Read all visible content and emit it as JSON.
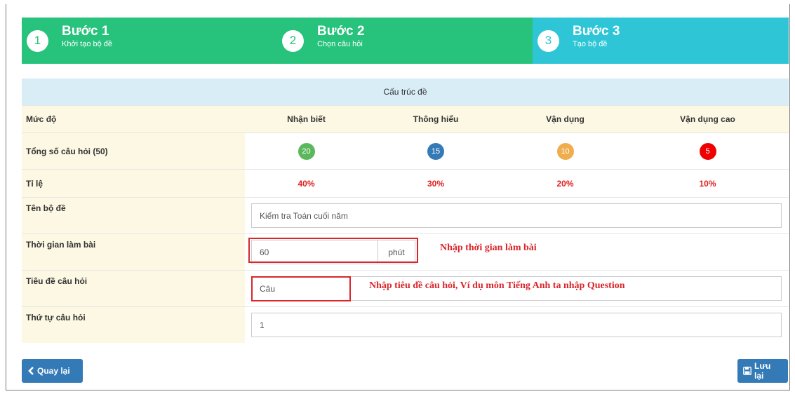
{
  "steps": [
    {
      "number": "1",
      "title": "Bước 1",
      "subtitle": "Khởi tạo bộ đề"
    },
    {
      "number": "2",
      "title": "Bước 2",
      "subtitle": "Chọn câu hỏi"
    },
    {
      "number": "3",
      "title": "Bước 3",
      "subtitle": "Tạo bộ đề"
    }
  ],
  "table": {
    "header": "Cấu trúc đề",
    "level_label": "Mức độ",
    "levels": [
      "Nhận biết",
      "Thông hiểu",
      "Vận dụng",
      "Vận dụng cao"
    ],
    "total_label": "Tổng số câu hỏi (50)",
    "counts": [
      "20",
      "15",
      "10",
      "5"
    ],
    "count_colors": [
      "#5cb85c",
      "#337ab7",
      "#f0ad4e",
      "#ee0000"
    ],
    "ratio_label": "Tỉ lệ",
    "ratios": [
      "40%",
      "30%",
      "20%",
      "10%"
    ]
  },
  "form": {
    "name_label": "Tên bộ đề",
    "name_value": "Kiểm tra Toán cuối năm",
    "time_label": "Thời gian làm bài",
    "time_value": "60",
    "time_unit": "phút",
    "time_note": "Nhập thời gian làm bài",
    "title_label": "Tiêu đề câu hỏi",
    "title_value": "Câu",
    "title_note": "Nhập tiêu đề câu hỏi, Ví dụ môn Tiếng Anh ta nhập Question",
    "order_label": "Thứ tự câu hỏi",
    "order_value": "1"
  },
  "buttons": {
    "back_label": "Quay lại",
    "save_label": "Lưu lại"
  },
  "colors": {
    "step_active": "#27c27c",
    "step_current": "#2ec6d6",
    "primary": "#337ab7",
    "annotation": "#d9262b"
  }
}
